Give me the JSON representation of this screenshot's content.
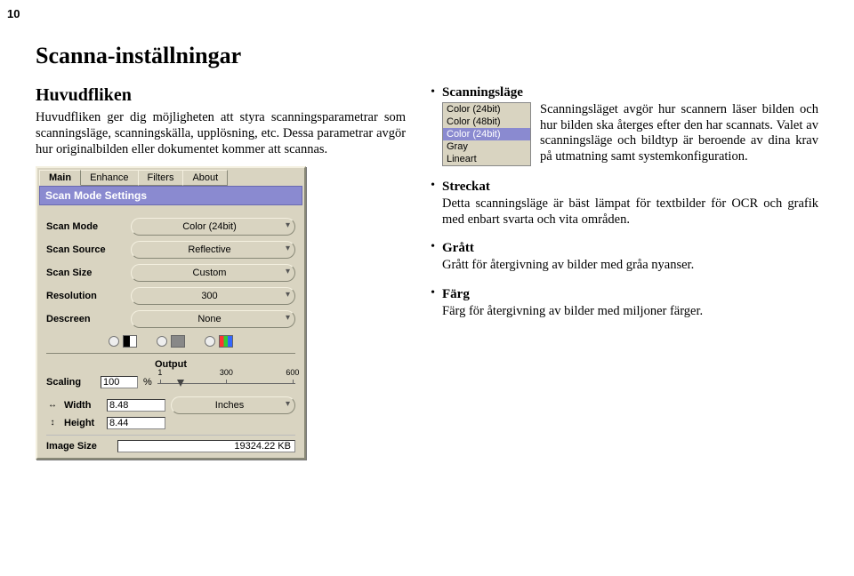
{
  "page_number": "10",
  "title": "Scanna-inställningar",
  "section_heading": "Huvudfliken",
  "intro_para": "Huvudfliken ger dig möjligheten att styra scanningsparametrar som scanningsläge, scanningskälla, upplösning, etc. Dessa parametrar avgör hur originalbilden eller dokumentet kommer att scannas.",
  "panel": {
    "tabs": [
      "Main",
      "Enhance",
      "Filters",
      "About"
    ],
    "title": "Scan Mode Settings",
    "rows": {
      "scan_mode_label": "Scan Mode",
      "scan_mode_value": "Color (24bit)",
      "scan_source_label": "Scan Source",
      "scan_source_value": "Reflective",
      "scan_size_label": "Scan Size",
      "scan_size_value": "Custom",
      "resolution_label": "Resolution",
      "resolution_value": "300",
      "descreen_label": "Descreen",
      "descreen_value": "None"
    },
    "output_label": "Output",
    "scaling_label": "Scaling",
    "scaling_value": "100",
    "scaling_pct": "%",
    "slider_ticks": {
      "t1": "1",
      "t300": "300",
      "t600": "600"
    },
    "width_label": "Width",
    "width_value": "8.48",
    "height_label": "Height",
    "height_value": "8.44",
    "units_value": "Inches",
    "image_size_label": "Image Size",
    "image_size_value": "19324.22 KB"
  },
  "mini_list": {
    "i0": "Color (24bit)",
    "i1": "Color (48bit)",
    "i2": "Color (24bit)",
    "i3": "Gray",
    "i4": "Lineart"
  },
  "items": {
    "scanningslage": {
      "title": "Scanningsläge",
      "text": "Scanningsläget avgör hur scannern läser bilden och hur bilden ska återges efter den har scannats. Valet av scanningsläge och bildtyp är beroende av dina krav på utmatning samt systemkonfiguration."
    },
    "streckat": {
      "title": "Streckat",
      "text": "Detta scanningsläge är bäst lämpat för textbilder för OCR och grafik med enbart svarta och vita områden."
    },
    "gratt": {
      "title": "Grått",
      "text": "Grått för återgivning av bilder med gråa nyanser."
    },
    "farg": {
      "title": "Färg",
      "text": "Färg för återgivning av bilder med miljoner färger."
    }
  }
}
